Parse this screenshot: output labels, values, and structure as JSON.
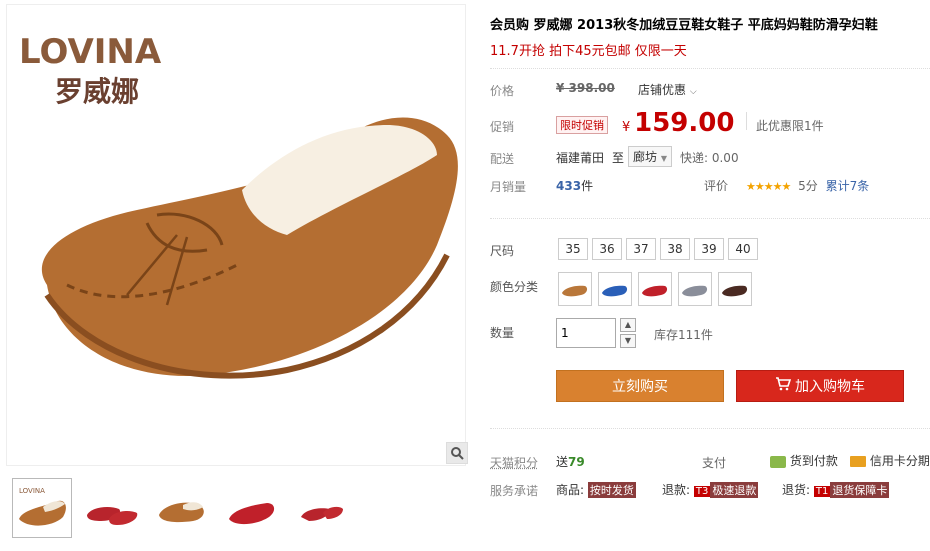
{
  "gallery": {
    "brand_logo": "LOVINA",
    "brand_logo_cn": "罗威娜",
    "zoom_icon": "magnifier-icon",
    "thumbnails": [
      "tan",
      "red",
      "tan-single",
      "red-single",
      "red-angle"
    ]
  },
  "product": {
    "title": "会员购 罗威娜 2013秋冬加绒豆豆鞋女鞋子 平底妈妈鞋防滑孕妇鞋",
    "subtitle": "11.7开抢 拍下45元包邮 仅限一天"
  },
  "price": {
    "label": "价格",
    "original": "¥ 398.00",
    "store_discount": "店铺优惠",
    "promo_label": "促销",
    "promo_tag": "限时促销",
    "currency": "¥",
    "current": "159.00",
    "limit": "此优惠限1件"
  },
  "shipping": {
    "label": "配送",
    "from": "福建莆田",
    "to_word": "至",
    "to": "廊坊",
    "express": "快递: 0.00"
  },
  "sales": {
    "label": "月销量",
    "count": "433",
    "unit": "件",
    "rating_label": "评价",
    "stars": "★★★★★",
    "score": "5分",
    "reviews": "累计7条"
  },
  "sizes": {
    "label": "尺码",
    "options": [
      "35",
      "36",
      "37",
      "38",
      "39",
      "40"
    ]
  },
  "colors": {
    "label": "颜色分类",
    "swatches": [
      "#b9773a",
      "#2a5fb8",
      "#c0202a",
      "#8a8e9a",
      "#4a2a22"
    ]
  },
  "quantity": {
    "label": "数量",
    "value": "1",
    "stock": "库存111件"
  },
  "actions": {
    "buy": "立刻购买",
    "cart": "加入购物车"
  },
  "points": {
    "label": "天猫积分",
    "value_prefix": "送",
    "value": "79",
    "pay_label": "支付",
    "cod": "货到付款",
    "installment": "信用卡分期"
  },
  "service": {
    "label": "服务承诺",
    "goods_prefix": "商品:",
    "goods_badge": "按时发货",
    "refund_prefix": "退款:",
    "refund_t": "T3",
    "refund_badge": "极速退款",
    "return_prefix": "退货:",
    "return_t": "T1",
    "return_badge": "退货保障卡"
  }
}
